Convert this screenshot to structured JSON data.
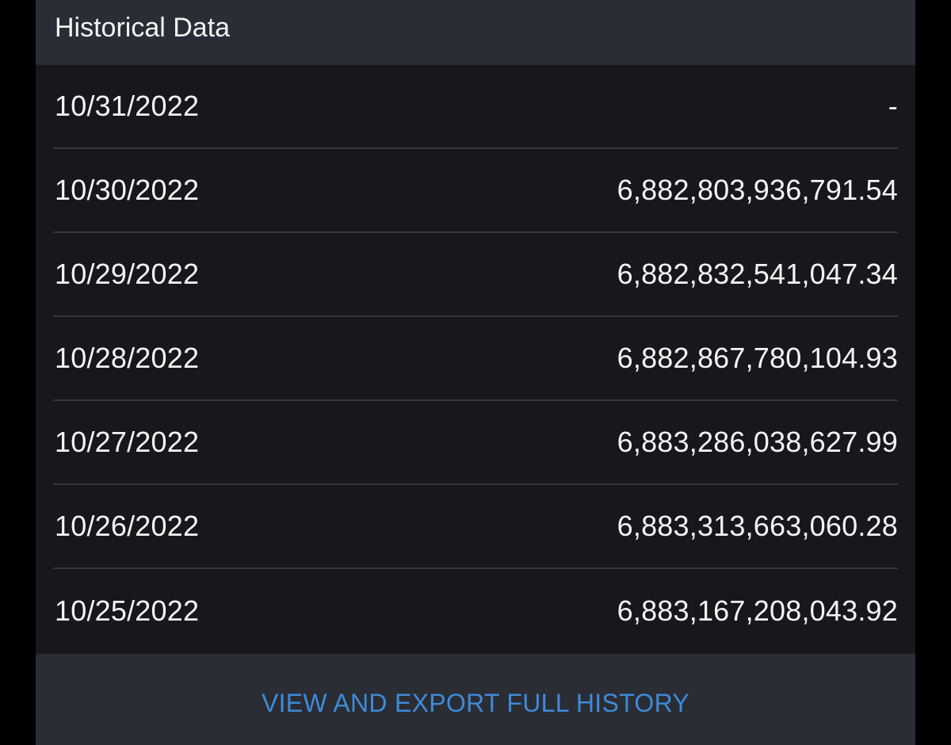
{
  "header": {
    "title": "Historical Data"
  },
  "rows": [
    {
      "date": "10/31/2022",
      "value": "-"
    },
    {
      "date": "10/30/2022",
      "value": "6,882,803,936,791.54"
    },
    {
      "date": "10/29/2022",
      "value": "6,882,832,541,047.34"
    },
    {
      "date": "10/28/2022",
      "value": "6,882,867,780,104.93"
    },
    {
      "date": "10/27/2022",
      "value": "6,883,286,038,627.99"
    },
    {
      "date": "10/26/2022",
      "value": "6,883,313,663,060.28"
    },
    {
      "date": "10/25/2022",
      "value": "6,883,167,208,043.92"
    }
  ],
  "footer": {
    "link_label": "VIEW AND EXPORT FULL HISTORY"
  },
  "colors": {
    "background": "#000000",
    "card": "#17181c",
    "header": "#2a2d34",
    "text": "#f4f4f5",
    "divider": "#34363c",
    "link": "#3f8ad8"
  }
}
